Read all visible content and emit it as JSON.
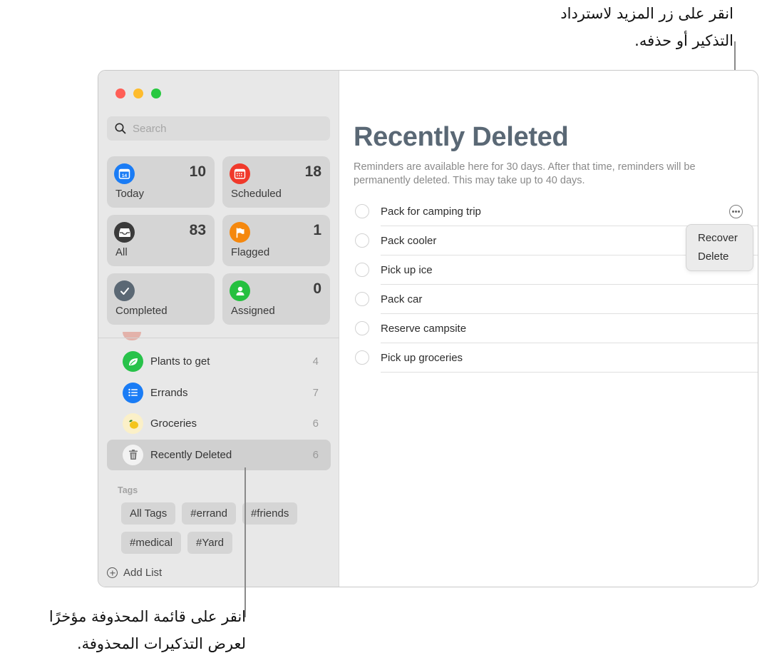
{
  "callouts": {
    "top": [
      "انقر على زر المزيد لاسترداد",
      "التذكير أو حذفه."
    ],
    "bottom": [
      "انقر على قائمة المحذوفة مؤخرًا",
      "لعرض التذكيرات المحذوفة."
    ]
  },
  "window": {
    "traffic_lights": {
      "close": "#ff5f57",
      "minimize": "#febc2e",
      "zoom": "#28c840"
    }
  },
  "sidebar": {
    "search": {
      "placeholder": "Search",
      "value": "",
      "icon": "magnifying-glass-icon"
    },
    "smart_lists": [
      {
        "label": "Today",
        "count": "10",
        "icon": "calendar-today-icon",
        "color": "#1a7cf5",
        "date": "14"
      },
      {
        "label": "Scheduled",
        "count": "18",
        "icon": "calendar-grid-icon",
        "color": "#f0392b"
      },
      {
        "label": "All",
        "count": "83",
        "icon": "tray-icon",
        "color": "#3b3b3b"
      },
      {
        "label": "Flagged",
        "count": "1",
        "icon": "flag-icon",
        "color": "#f5880e"
      },
      {
        "label": "Completed",
        "count": "",
        "icon": "checkmark-icon",
        "color": "#5b6874"
      },
      {
        "label": "Assigned",
        "count": "0",
        "icon": "person-icon",
        "color": "#25c03f"
      }
    ],
    "lists": [
      {
        "name": "Plants to get",
        "count": "4",
        "icon": "leaf-icon",
        "color": "#28c24a"
      },
      {
        "name": "Errands",
        "count": "7",
        "icon": "list-bullet-icon",
        "color": "#1a7cf5"
      },
      {
        "name": "Groceries",
        "count": "6",
        "icon": "lemon-icon",
        "color": "#fbf0c8"
      },
      {
        "name": "Recently Deleted",
        "count": "6",
        "icon": "trash-icon",
        "color": "#f2f2f2",
        "selected": true
      }
    ],
    "tags_title": "Tags",
    "tags": [
      "All Tags",
      "#errand",
      "#friends",
      "#medical",
      "#Yard"
    ],
    "add_list_label": "Add List"
  },
  "main": {
    "title": "Recently Deleted",
    "description": "Reminders are available here for 30 days. After that time, reminders will be permanently deleted. This may take up to 40 days.",
    "title_color": "#5a6875",
    "reminders": [
      "Pack for camping trip",
      "Pack cooler",
      "Pick up ice",
      "Pack car",
      "Reserve campsite",
      "Pick up groceries"
    ],
    "more_menu": {
      "items": [
        "Recover",
        "Delete"
      ]
    }
  }
}
